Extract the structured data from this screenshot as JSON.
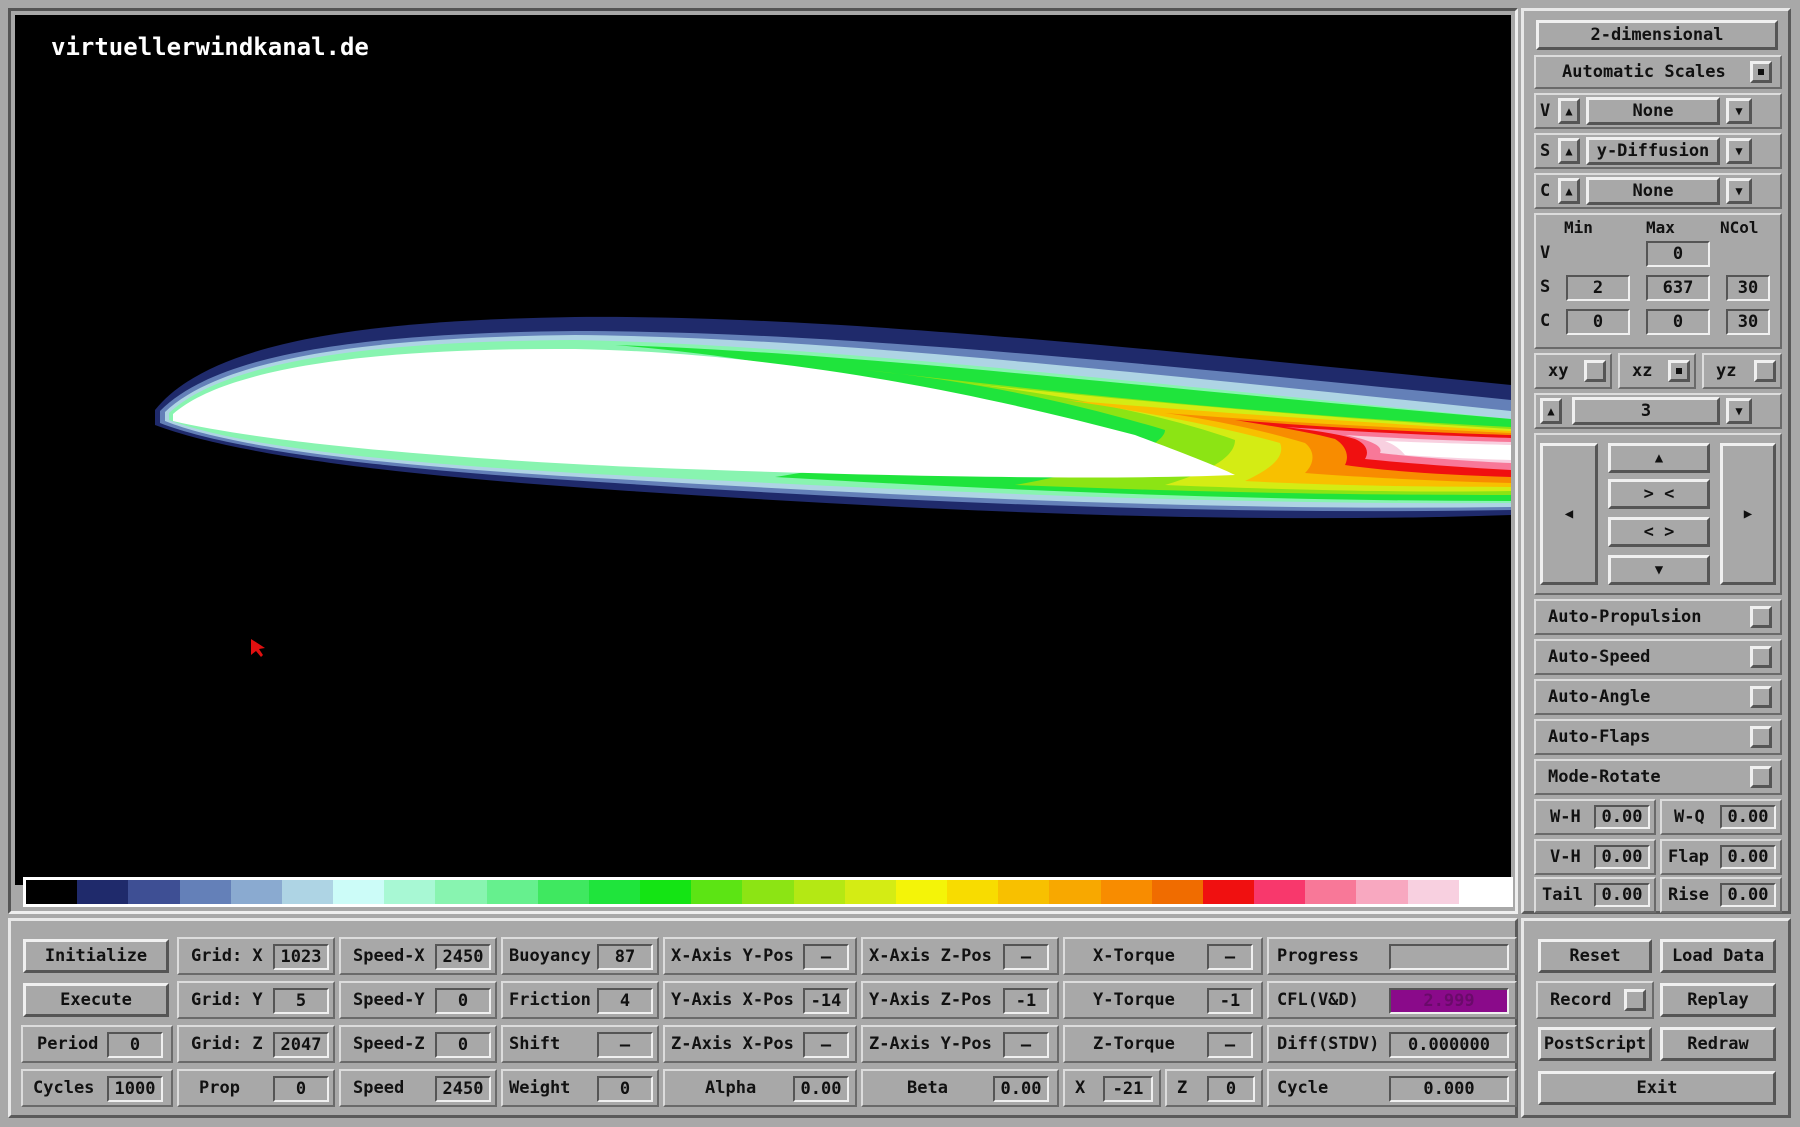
{
  "site_label": "virtuellerwindkanal.de",
  "colors": {
    "scale": [
      "#000000",
      "#1f2a6b",
      "#3e4f94",
      "#6480b8",
      "#8aaad0",
      "#aed4e4",
      "#ccfcf8",
      "#a8f8d4",
      "#88f4b0",
      "#66f08e",
      "#3fe860",
      "#1fe43c",
      "#14e414",
      "#5ce414",
      "#8ce414",
      "#b4e814",
      "#d4ec14",
      "#f4f408",
      "#f8dc00",
      "#f8c000",
      "#f8a800",
      "#f88c00",
      "#f06c00",
      "#f01010",
      "#f8386c",
      "#f87898",
      "#f8a8c0",
      "#f8d0e0",
      "#ffffff"
    ],
    "cfl_bar": "#8a0a8a"
  },
  "right": {
    "mode_button": "2-dimensional",
    "auto_scales": "Automatic Scales",
    "vector": {
      "letter": "V",
      "value": "None"
    },
    "scalar": {
      "letter": "S",
      "value": "y-Diffusion"
    },
    "color": {
      "letter": "C",
      "value": "None"
    },
    "headers": {
      "min": "Min",
      "max": "Max",
      "ncol": "NCol"
    },
    "rows": {
      "v": {
        "label": "V",
        "max": "0"
      },
      "s": {
        "label": "S",
        "min": "2",
        "max": "637",
        "ncol": "30"
      },
      "c": {
        "label": "C",
        "min": "0",
        "max": "0",
        "ncol": "30"
      }
    },
    "planes": {
      "xy": "xy",
      "xz": "xz",
      "yz": "yz"
    },
    "slice": "3",
    "toggles": [
      "Auto-Propulsion",
      "Auto-Speed",
      "Auto-Angle",
      "Auto-Flaps",
      "Mode-Rotate"
    ],
    "params": {
      "wh": {
        "label": "W-H",
        "value": "0.00"
      },
      "wq": {
        "label": "W-Q",
        "value": "0.00"
      },
      "vh": {
        "label": "V-H",
        "value": "0.00"
      },
      "flap": {
        "label": "Flap",
        "value": "0.00"
      },
      "tail": {
        "label": "Tail",
        "value": "0.00"
      },
      "rise": {
        "label": "Rise",
        "value": "0.00"
      }
    }
  },
  "bottom": {
    "initialize": "Initialize",
    "execute": "Execute",
    "period": {
      "label": "Period",
      "value": "0"
    },
    "cycles": {
      "label": "Cycles",
      "value": "1000"
    },
    "gridx": {
      "label": "Grid: X",
      "value": "1023"
    },
    "gridy": {
      "label": "Grid: Y",
      "value": "5"
    },
    "gridz": {
      "label": "Grid: Z",
      "value": "2047"
    },
    "prop": {
      "label": "Prop",
      "value": "0"
    },
    "speedx": {
      "label": "Speed-X",
      "value": "2450"
    },
    "speedy": {
      "label": "Speed-Y",
      "value": "0"
    },
    "speedz": {
      "label": "Speed-Z",
      "value": "0"
    },
    "speed": {
      "label": "Speed",
      "value": "2450"
    },
    "buoyancy": {
      "label": "Buoyancy",
      "value": "87"
    },
    "friction": {
      "label": "Friction",
      "value": "4"
    },
    "shift": {
      "label": "Shift",
      "value": "—"
    },
    "weight": {
      "label": "Weight",
      "value": "0"
    },
    "xaxisypos": {
      "label": "X-Axis Y-Pos",
      "value": "—"
    },
    "yaxisxpos": {
      "label": "Y-Axis X-Pos",
      "value": "-14"
    },
    "zaxisxpos": {
      "label": "Z-Axis X-Pos",
      "value": "—"
    },
    "alpha": {
      "label": "Alpha",
      "value": "0.00"
    },
    "xaxiszpos": {
      "label": "X-Axis Z-Pos",
      "value": "—"
    },
    "yaxiszpos": {
      "label": "Y-Axis Z-Pos",
      "value": "-1"
    },
    "zaxisypos": {
      "label": "Z-Axis Y-Pos",
      "value": "—"
    },
    "beta": {
      "label": "Beta",
      "value": "0.00"
    },
    "xtorque": {
      "label": "X-Torque",
      "value": "—"
    },
    "ytorque": {
      "label": "Y-Torque",
      "value": "-1"
    },
    "ztorque": {
      "label": "Z-Torque",
      "value": "—"
    },
    "x": {
      "label": "X",
      "value": "-21"
    },
    "z": {
      "label": "Z",
      "value": "0"
    },
    "progress": {
      "label": "Progress",
      "value": ""
    },
    "cfl": {
      "label": "CFL(V&D)",
      "value": "2.999"
    },
    "diff": {
      "label": "Diff(STDV)",
      "value": "0.000000"
    },
    "cycle": {
      "label": "Cycle",
      "value": "0.000"
    },
    "reset": "Reset",
    "loaddata": "Load Data",
    "record": "Record",
    "replay": "Replay",
    "postscript": "PostScript",
    "redraw": "Redraw",
    "exit": "Exit"
  }
}
